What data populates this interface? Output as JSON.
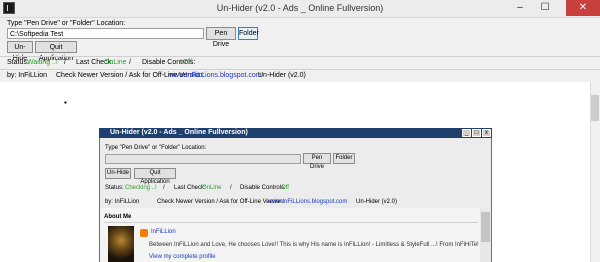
{
  "window": {
    "title": "Un-Hider (v2.0 - Ads _ Online Fullversion)",
    "controls": {
      "minimize": "–",
      "maximize": "☐",
      "close": "✕"
    }
  },
  "location": {
    "label": "Type \"Pen Drive\" or \"Folder\" Location:",
    "value": "C:\\Softpedia Test",
    "pen_drive_button": "Pen Drive",
    "folder_button": "Folder"
  },
  "actions": {
    "unhide_button": "Un-Hide",
    "quit_button": "Quit Application"
  },
  "status": {
    "status_label": "Status:",
    "status_value": "Waiting ..!",
    "slash1": "/",
    "last_check_label": "Last Check:",
    "last_check_value": "OnLine",
    "slash2": "/",
    "disable_label": "Disable Controls:",
    "disable_value": "Off"
  },
  "info": {
    "author": "by: InFiLLion",
    "check_label": "Check Newer Version / Ask for Off-Line Version:",
    "link": "www.InFiLLions.blogspot.com",
    "version": "Un-Hider (v2.0)"
  },
  "web": {
    "marker": "▪"
  },
  "inner": {
    "title": "Un-Hider (v2.0 - Ads _ Online Fullversion)",
    "controls": {
      "minimize": "_",
      "maximize": "□",
      "close": "x"
    },
    "location_label": "Type \"Pen Drive\" or \"Folder\" Location:",
    "pen_drive_button": "Pen Drive",
    "folder_button": "Folder",
    "unhide_button": "Un-Hide",
    "quit_button": "Quit Application",
    "status_label": "Status:",
    "status_value": "Checking ..!",
    "slash1": "/",
    "last_check_label": "Last Check:",
    "last_check_value": "OnLine",
    "slash2": "/",
    "disable_label": "Disable Controls:",
    "disable_value": "Off",
    "author": "by: InFiLLion",
    "check_label": "Check Newer Version / Ask for Off-Line Version:",
    "link": "www.InFiLLions.blogspot.com",
    "version": "Un-Hider (v2.0)",
    "about_heading": "About Me",
    "profile_name": "InFiLLion",
    "bio": "Between InFiLLion and Love, He chooses Love!! This is why His name is InFiLLion! - Limitless & StyleFull ...! From InFiHiTe!",
    "profile_link": "View my complete profile"
  },
  "colors": {
    "accent_green": "#2e9d2e",
    "link_blue": "#1a37c8",
    "inner_title_bg": "#1f3f6e"
  }
}
